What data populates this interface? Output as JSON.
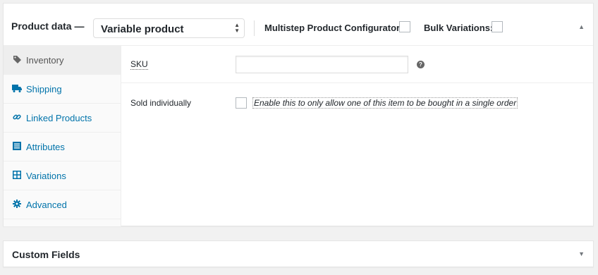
{
  "product_data": {
    "title": "Product data —",
    "type_select": {
      "value": "Variable product"
    },
    "multistep_label": "Multistep Product Configurator:",
    "bulk_label": "Bulk Variations:",
    "toggle_glyph": "▲"
  },
  "tabs": [
    {
      "label": "Inventory",
      "icon": "tag-icon",
      "active": true
    },
    {
      "label": "Shipping",
      "icon": "truck-icon"
    },
    {
      "label": "Linked Products",
      "icon": "link-icon"
    },
    {
      "label": "Attributes",
      "icon": "list-icon"
    },
    {
      "label": "Variations",
      "icon": "grid-icon"
    },
    {
      "label": "Advanced",
      "icon": "gear-icon"
    }
  ],
  "inventory": {
    "sku_label": "SKU",
    "sku_value": "",
    "sold_individually_label": "Sold individually",
    "sold_individually_desc": "Enable this to only allow one of this item to be bought in a single order"
  },
  "custom_fields": {
    "title": "Custom Fields",
    "toggle_glyph": "▼"
  },
  "colors": {
    "link": "#0073aa",
    "active_tab_bg": "#eeeeee",
    "border": "#e5e5e5"
  }
}
